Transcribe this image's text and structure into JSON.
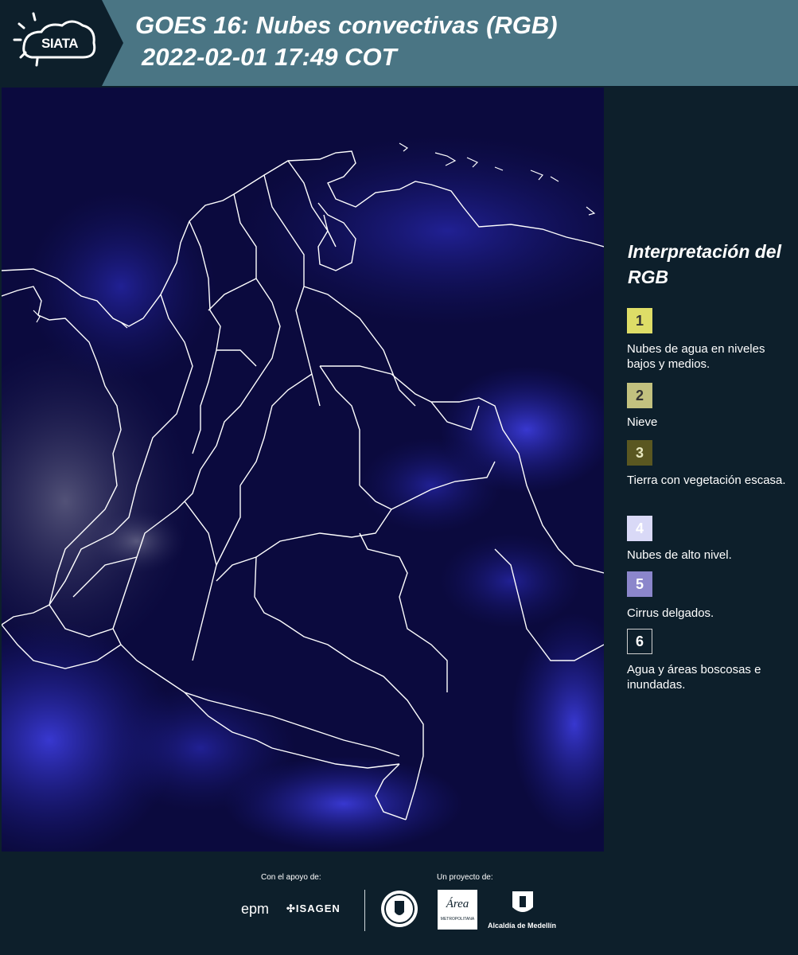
{
  "header": {
    "logo_text": "SIATA",
    "title_line1": "GOES 16: Nubes convectivas (RGB)",
    "title_line2": "2022-02-01 17:49 COT",
    "colors": {
      "header_bg": "#4a7584",
      "logo_bg": "#0d1f2b"
    }
  },
  "map": {
    "icon": "satellite-rgb-image",
    "colors": {
      "background": "#0b0a3e",
      "clouds_high": "#3b3bd6",
      "borders": "#ffffff"
    }
  },
  "legend": {
    "title": "Interpretación del RGB",
    "items": [
      {
        "number": "1",
        "label": "Nubes de agua en niveles bajos y medios.",
        "color": "#dedd67"
      },
      {
        "number": "2",
        "label": "Nieve",
        "color": "#c2c17f"
      },
      {
        "number": "3",
        "label": "Tierra con vegetación escasa.",
        "color": "#5a5721"
      },
      {
        "number": "4",
        "label": "Nubes de alto nivel.",
        "color": "#d9d9f7"
      },
      {
        "number": "5",
        "label": "Cirrus delgados.",
        "color": "#8b86cb"
      },
      {
        "number": "6",
        "label": "Agua y áreas boscosas e inundadas.",
        "color": "#0d1f2b"
      }
    ]
  },
  "footer": {
    "support_label": "Con el apoyo de:",
    "project_label": "Un proyecto de:",
    "sponsors": [
      "epm",
      "ISAGEN"
    ],
    "partners": [
      "METROPOLITANA",
      "Alcaldía de Medellín"
    ],
    "area_logo_text": "Área"
  }
}
